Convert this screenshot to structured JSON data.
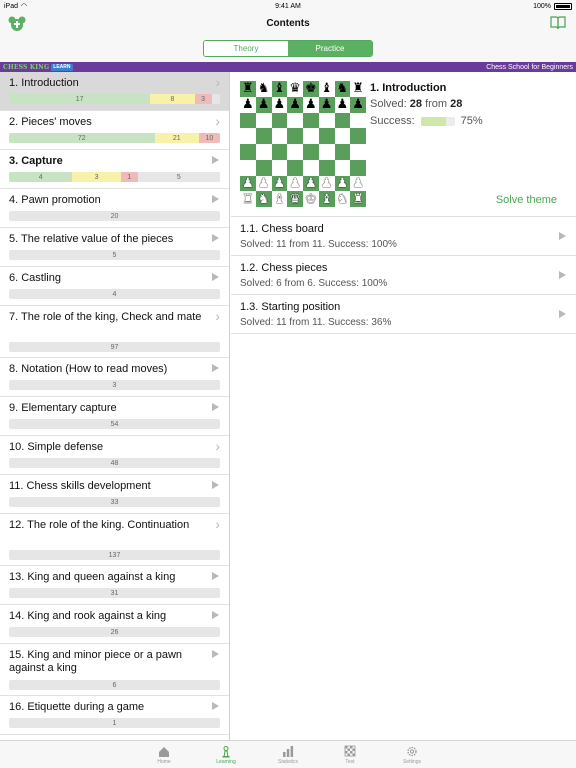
{
  "status": {
    "device": "iPad",
    "time": "9:41 AM",
    "battery": "100%"
  },
  "nav": {
    "title": "Contents"
  },
  "segments": [
    {
      "label": "Theory",
      "active": false
    },
    {
      "label": "Practice",
      "active": true
    }
  ],
  "banner": {
    "logo_text": "CHESS KING",
    "logo_badge": "LEARN",
    "subtitle": "Chess School for Beginners"
  },
  "lessons": [
    {
      "title": "1. Introduction",
      "bold": false,
      "selected": true,
      "marker": "chevron",
      "progress": [
        {
          "v": "17",
          "c": "green",
          "w": 0.67
        },
        {
          "v": "8",
          "c": "yellow",
          "w": 0.21
        },
        {
          "v": "3",
          "c": "red",
          "w": 0.08
        }
      ]
    },
    {
      "title": "2. Pieces' moves",
      "bold": false,
      "selected": false,
      "marker": "chevron",
      "progress": [
        {
          "v": "72",
          "c": "green",
          "w": 0.69
        },
        {
          "v": "21",
          "c": "yellow",
          "w": 0.21
        },
        {
          "v": "10",
          "c": "red",
          "w": 0.1
        }
      ]
    },
    {
      "title": "3. Capture",
      "bold": true,
      "selected": false,
      "marker": "triangle",
      "progress": [
        {
          "v": "4",
          "c": "green",
          "w": 0.3
        },
        {
          "v": "3",
          "c": "yellow",
          "w": 0.23
        },
        {
          "v": "1",
          "c": "red",
          "w": 0.08
        },
        {
          "v": "5",
          "c": "grey",
          "w": 0.39
        }
      ]
    },
    {
      "title": "4. Pawn promotion",
      "bold": false,
      "selected": false,
      "marker": "triangle",
      "progress": [
        {
          "v": "20",
          "c": "grey",
          "w": 1
        }
      ]
    },
    {
      "title": "5. The relative value of the pieces",
      "bold": false,
      "selected": false,
      "marker": "triangle",
      "progress": [
        {
          "v": "5",
          "c": "grey",
          "w": 1
        }
      ]
    },
    {
      "title": "6. Castling",
      "bold": false,
      "selected": false,
      "marker": "triangle",
      "progress": [
        {
          "v": "4",
          "c": "grey",
          "w": 1
        }
      ]
    },
    {
      "title": "7. The role of the king, Check and mate",
      "bold": false,
      "selected": false,
      "marker": "chevron",
      "progress": [
        {
          "v": "97",
          "c": "grey",
          "w": 1
        }
      ]
    },
    {
      "title": "8. Notation (How to read moves)",
      "bold": false,
      "selected": false,
      "marker": "triangle",
      "progress": [
        {
          "v": "3",
          "c": "grey",
          "w": 1
        }
      ]
    },
    {
      "title": "9. Elementary capture",
      "bold": false,
      "selected": false,
      "marker": "triangle",
      "progress": [
        {
          "v": "54",
          "c": "grey",
          "w": 1
        }
      ]
    },
    {
      "title": "10. Simple defense",
      "bold": false,
      "selected": false,
      "marker": "chevron",
      "progress": [
        {
          "v": "48",
          "c": "grey",
          "w": 1
        }
      ]
    },
    {
      "title": "11. Chess skills development",
      "bold": false,
      "selected": false,
      "marker": "triangle",
      "progress": [
        {
          "v": "33",
          "c": "grey",
          "w": 1
        }
      ]
    },
    {
      "title": "12. The role of the king. Continuation",
      "bold": false,
      "selected": false,
      "marker": "chevron",
      "progress": [
        {
          "v": "137",
          "c": "grey",
          "w": 1
        }
      ]
    },
    {
      "title": "13. King and queen against a king",
      "bold": false,
      "selected": false,
      "marker": "triangle",
      "progress": [
        {
          "v": "31",
          "c": "grey",
          "w": 1
        }
      ]
    },
    {
      "title": "14. King and rook against a king",
      "bold": false,
      "selected": false,
      "marker": "triangle",
      "progress": [
        {
          "v": "26",
          "c": "grey",
          "w": 1
        }
      ]
    },
    {
      "title": "15. King and minor piece or a pawn against a king",
      "bold": false,
      "selected": false,
      "marker": "triangle",
      "progress": [
        {
          "v": "6",
          "c": "grey",
          "w": 1
        }
      ]
    },
    {
      "title": "16. Etiquette during a game",
      "bold": false,
      "selected": false,
      "marker": "triangle",
      "progress": [
        {
          "v": "1",
          "c": "grey",
          "w": 1
        }
      ]
    }
  ],
  "detail": {
    "title": "1. Introduction",
    "solved_label": "Solved:",
    "solved_value": "28",
    "solved_from": "from",
    "solved_total": "28",
    "success_label": "Success:",
    "success_value": "75%",
    "success_fraction": 0.75,
    "solve_button": "Solve theme",
    "board": [
      [
        "bR",
        "bN",
        "bB",
        "bQ",
        "bK",
        "bB",
        "bN",
        "bR"
      ],
      [
        "bP",
        "bP",
        "bP",
        "bP",
        "bP",
        "bP",
        "bP",
        "bP"
      ],
      [
        "",
        "",
        "",
        "",
        "",
        "",
        "",
        ""
      ],
      [
        "",
        "",
        "",
        "",
        "",
        "",
        "",
        ""
      ],
      [
        "",
        "",
        "",
        "",
        "",
        "",
        "",
        ""
      ],
      [
        "",
        "",
        "",
        "",
        "",
        "",
        "",
        ""
      ],
      [
        "wP",
        "wP",
        "wP",
        "wP",
        "wP",
        "wP",
        "wP",
        "wP"
      ],
      [
        "wR",
        "wN",
        "wB",
        "wQ",
        "wK",
        "wB",
        "wN",
        "wR"
      ]
    ],
    "sub_items": [
      {
        "title": "1.1. Chess board",
        "info": "Solved: 11 from 11. Success: 100%"
      },
      {
        "title": "1.2. Chess pieces",
        "info": "Solved: 6 from 6. Success: 100%"
      },
      {
        "title": "1.3. Starting position",
        "info": "Solved: 11 from 11. Success: 36%"
      }
    ]
  },
  "tabs": [
    {
      "label": "Home",
      "icon": "home-icon",
      "active": false
    },
    {
      "label": "Learning",
      "icon": "pawn-icon",
      "active": true
    },
    {
      "label": "Statistics",
      "icon": "bar-chart-icon",
      "active": false
    },
    {
      "label": "Test",
      "icon": "checkerboard-icon",
      "active": false
    },
    {
      "label": "Settings",
      "icon": "gear-icon",
      "active": false
    }
  ],
  "colors": {
    "accent": "#4aa555",
    "banner": "#6a3b99",
    "board_dark": "#5a9e5c"
  }
}
